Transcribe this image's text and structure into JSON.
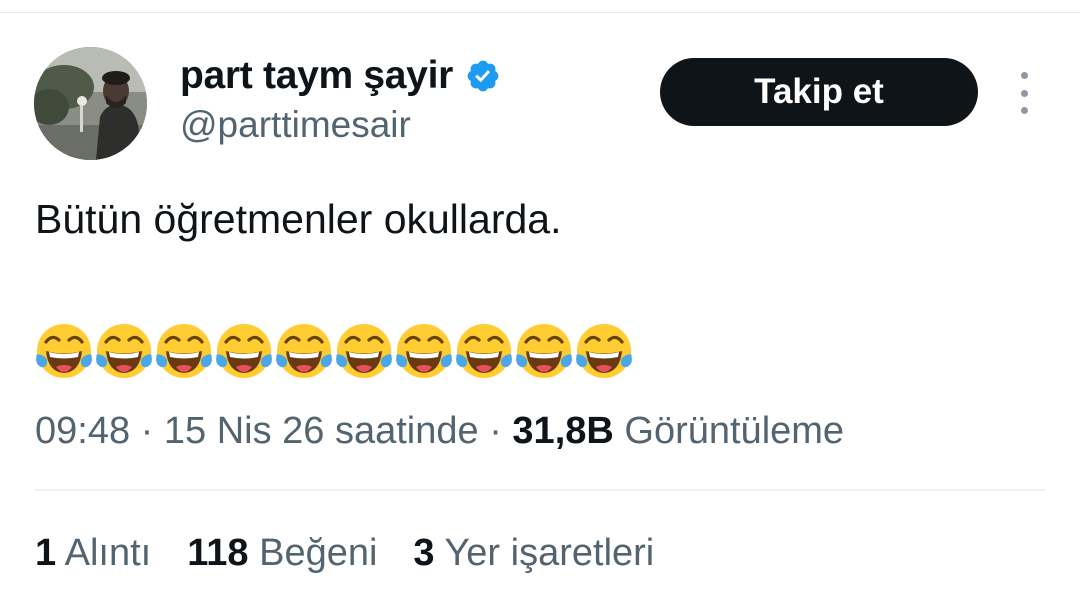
{
  "user": {
    "display_name": "part taym şayir",
    "handle": "@parttimesair",
    "verified": true,
    "verified_color": "#1d9bf0"
  },
  "actions": {
    "follow_label": "Takip et",
    "more_icon": "more-vertical-icon"
  },
  "tweet": {
    "text": "Bütün öğretmenler okullarda.",
    "emoji": "face-with-tears-of-joy",
    "emoji_count": 10
  },
  "meta": {
    "time": "09:48",
    "separator": "·",
    "date": "15 Nis 26 saatinde",
    "views_count": "31,8B",
    "views_label": "Görüntüleme"
  },
  "stats": {
    "quotes_count": "1",
    "quotes_label": "Alıntı",
    "likes_count": "118",
    "likes_label": "Beğeni",
    "bookmarks_count": "3",
    "bookmarks_label": "Yer işaretleri"
  },
  "colors": {
    "text_primary": "#0f1419",
    "text_secondary": "#536471",
    "follow_button_bg": "#0f1419",
    "divider": "#eff3f4"
  }
}
